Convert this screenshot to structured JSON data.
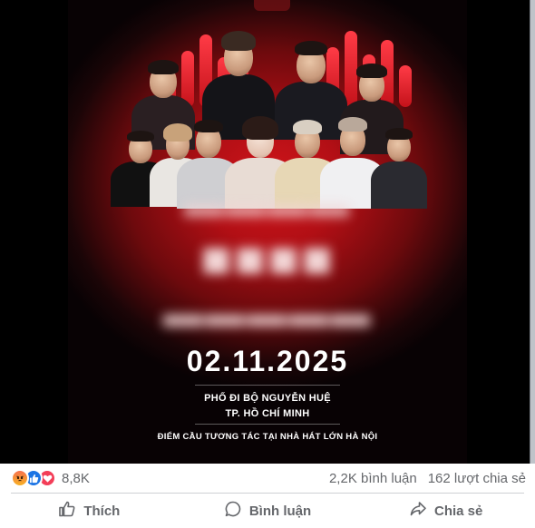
{
  "post": {
    "image": {
      "date": "02.11.2025",
      "venue_line1": "PHỐ ĐI BỘ NGUYỄN HUỆ",
      "venue_line2": "TP. HỒ CHÍ MINH",
      "venue_line3": "ĐIỂM CẦU TƯƠNG TÁC TẠI NHÀ HÁT LỚN HÀ NỘI"
    },
    "reactions": {
      "icons": [
        "angry-icon",
        "like-icon",
        "love-icon"
      ],
      "count": "8,8K"
    },
    "comments_count": "2,2K bình luận",
    "shares_count": "162 lượt chia sẻ",
    "actions": {
      "like": "Thích",
      "comment": "Bình luận",
      "share": "Chia sẻ"
    }
  },
  "colors": {
    "accent_red": "#d0151b",
    "text_secondary": "#65676b",
    "like_blue": "#1b74e4",
    "love_red": "#f33e58"
  }
}
